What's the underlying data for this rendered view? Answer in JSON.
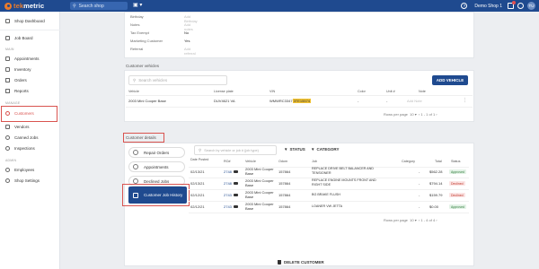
{
  "topbar": {
    "logo_prefix": "tek",
    "logo_suffix": "metric",
    "search_placeholder": "Search shop",
    "shop_name": "Demo Shop 1",
    "user_initials": "TU"
  },
  "sidebar": {
    "shop_dashboard": "Shop Dashboard",
    "job_board": "Job Board",
    "section_main": "MAIN",
    "appointments": "Appointments",
    "inventory": "Inventory",
    "orders": "Orders",
    "reports": "Reports",
    "section_manage": "MANAGE",
    "customers": "Customers",
    "vendors": "Vendors",
    "canned_jobs": "Canned Jobs",
    "inspections": "Inspections",
    "section_admin": "ADMIN",
    "employees": "Employees",
    "shop_settings": "Shop Settings"
  },
  "customer_info": {
    "rows": [
      {
        "label": "Birthday",
        "value": "Add Birthday",
        "faint": true
      },
      {
        "label": "Notes",
        "value": "Add notes",
        "faint": true
      },
      {
        "label": "Tax Exempt",
        "value": "No",
        "faint": false
      },
      {
        "label": "Marketing Customer",
        "value": "Yes",
        "faint": false
      },
      {
        "label": "Referral",
        "value": "Add referral",
        "faint": true
      }
    ]
  },
  "vehicles": {
    "section_title": "Customer vehicles",
    "search_placeholder": "Search vehicles",
    "add_button": "ADD VEHICLE",
    "columns": [
      "Vehicle",
      "License plate",
      "VIN",
      "Color",
      "Unit #",
      "Note"
    ],
    "row": {
      "vehicle": "2003 Mini Cooper Base",
      "plate": "DUV4621 VA",
      "vin_prefix": "WMWRC3347",
      "vin_highlight": "3TE15574",
      "color": "-",
      "unit": "-",
      "note": "Add Note"
    },
    "rows_per_page_label": "Rows per page",
    "rows_per_page": "10",
    "range": "1 - 1 of 1"
  },
  "details": {
    "section_title": "Customer details",
    "tabs": [
      "Repair Orders",
      "Appointments",
      "Declined Jobs",
      "Customer Job History"
    ],
    "search_placeholder": "Search by vehicle or job # (job type)",
    "filter_status": "STATUS",
    "filter_category": "CATEGORY",
    "columns": [
      "Date Posted",
      "RO#",
      "Vehicle",
      "Odom",
      "Job",
      "Category",
      "Total",
      "Status"
    ],
    "rows": [
      {
        "date": "02/13/21",
        "ro": "2748",
        "vehicle": "2003 Mini Cooper Base",
        "odom": "157864",
        "job": "REPLACE DRIVE BELT BALANCER AND TENSIONER",
        "category": "-",
        "total": "$562.28",
        "status": "Approved"
      },
      {
        "date": "02/13/21",
        "ro": "2748",
        "vehicle": "2003 Mini Cooper Base",
        "odom": "157864",
        "job": "REPLACE ENGINE MOUNTS FRONT AND RIGHT SIDE",
        "category": "-",
        "total": "$794.14",
        "status": "Declined"
      },
      {
        "date": "02/12/21",
        "ro": "2743",
        "vehicle": "2003 Mini Cooper Base",
        "odom": "157864",
        "job": "BG BRAKE FLUSH",
        "category": "-",
        "total": "$159.79",
        "status": "Declined"
      },
      {
        "date": "02/12/21",
        "ro": "2743",
        "vehicle": "2003 Mini Cooper Base",
        "odom": "157864",
        "job": "LOANER VW JETTA",
        "category": "-",
        "total": "$0.00",
        "status": "Approved"
      }
    ],
    "rows_per_page_label": "Rows per page",
    "rows_per_page": "10",
    "range": "1 - 4 of 4"
  },
  "delete_label": "DELETE CUSTOMER",
  "colors": {
    "brand": "#1f4a8f",
    "accent": "#e87b2c",
    "highlight": "#d9534f"
  }
}
